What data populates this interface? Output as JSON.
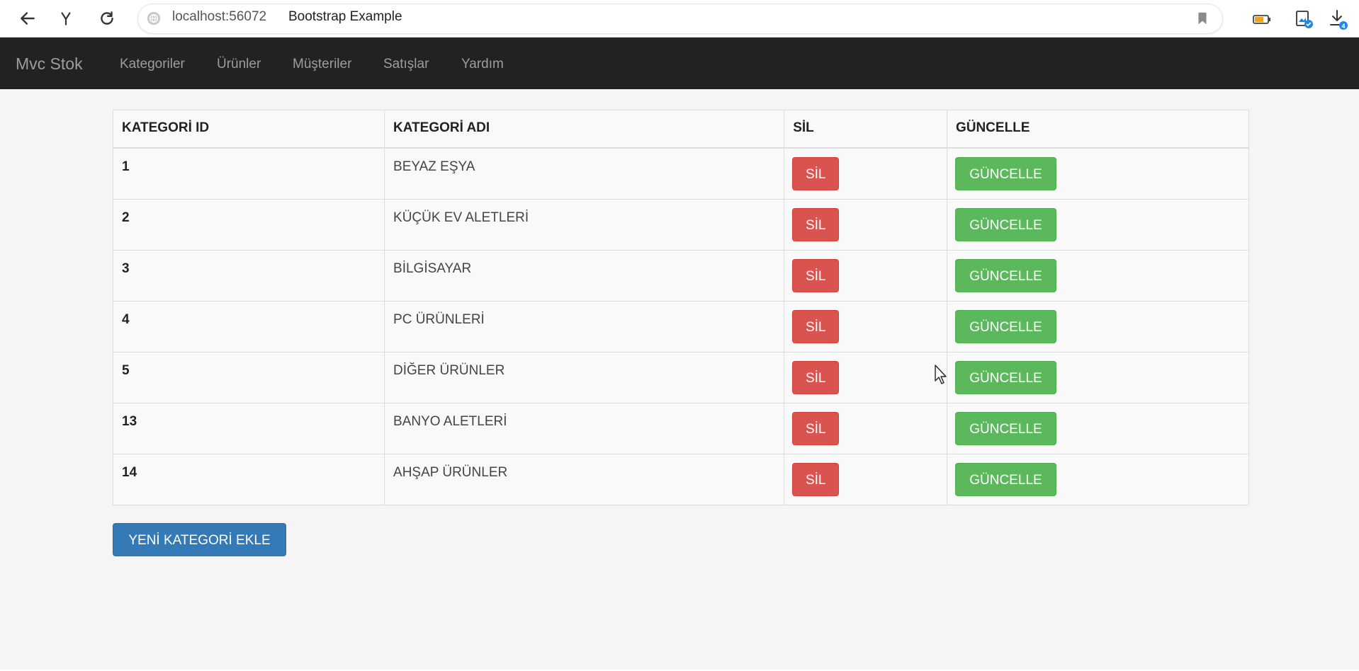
{
  "browser": {
    "url_host": "localhost:56072",
    "page_title": "Bootstrap Example",
    "download_badge": "4"
  },
  "navbar": {
    "brand": "Mvc Stok",
    "links": [
      "Kategoriler",
      "Ürünler",
      "Müşteriler",
      "Satışlar",
      "Yardım"
    ]
  },
  "table": {
    "headers": [
      "KATEGORİ ID",
      "KATEGORİ ADI",
      "SİL",
      "GÜNCELLE"
    ],
    "rows": [
      {
        "id": "1",
        "name": "BEYAZ EŞYA",
        "delete": "SİL",
        "update": "GÜNCELLE"
      },
      {
        "id": "2",
        "name": "KÜÇÜK EV ALETLERİ",
        "delete": "SİL",
        "update": "GÜNCELLE"
      },
      {
        "id": "3",
        "name": "BİLGİSAYAR",
        "delete": "SİL",
        "update": "GÜNCELLE"
      },
      {
        "id": "4",
        "name": "PC ÜRÜNLERİ",
        "delete": "SİL",
        "update": "GÜNCELLE"
      },
      {
        "id": "5",
        "name": "DİĞER ÜRÜNLER",
        "delete": "SİL",
        "update": "GÜNCELLE"
      },
      {
        "id": "13",
        "name": "BANYO ALETLERİ",
        "delete": "SİL",
        "update": "GÜNCELLE"
      },
      {
        "id": "14",
        "name": "AHŞAP ÜRÜNLER",
        "delete": "SİL",
        "update": "GÜNCELLE"
      }
    ]
  },
  "add_button": "YENİ KATEGORİ EKLE",
  "colors": {
    "navbar": "#222222",
    "danger": "#d9534f",
    "success": "#5cb85c",
    "primary": "#337ab7"
  },
  "icons": [
    "back-arrow-icon",
    "yandex-icon",
    "reload-icon",
    "globe-icon",
    "bookmark-icon",
    "battery-icon",
    "image-extension-icon",
    "download-icon",
    "mouse-cursor-icon"
  ]
}
